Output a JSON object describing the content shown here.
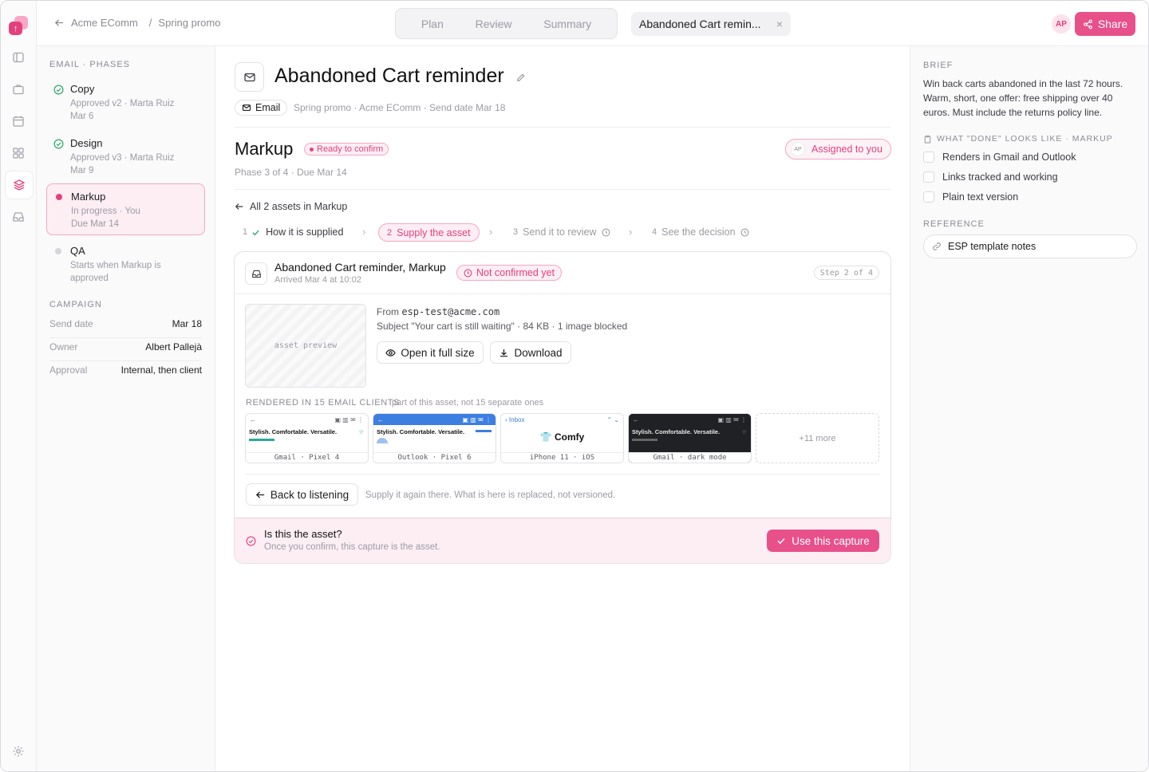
{
  "colors": {
    "accent": "#e5407e",
    "success": "#2aa867",
    "muted": "#9b9ba3"
  },
  "rail": {
    "icons": [
      "app-logo",
      "sidebar-toggle-icon",
      "briefcase-icon",
      "calendar-icon",
      "grid-icon",
      "layers-icon",
      "inbox-icon",
      "settings-icon"
    ]
  },
  "breadcrumb": {
    "parent": "Acme EComm",
    "separator": "/",
    "current": "Spring promo"
  },
  "tabs": [
    "Plan",
    "Review",
    "Summary"
  ],
  "doc_tab": {
    "title": "Abandoned Cart remin...",
    "close": "×"
  },
  "user": {
    "initials": "AP"
  },
  "share_label": "Share",
  "sidebar": {
    "phases_header": "EMAIL · PHASES",
    "phases": [
      {
        "title": "Copy",
        "sub": "Approved v2 · Marta Ruiz",
        "date": "Mar 6",
        "status": "done"
      },
      {
        "title": "Design",
        "sub": "Approved v3 · Marta Ruiz",
        "date": "Mar 9",
        "status": "done"
      },
      {
        "title": "Markup",
        "sub": "In progress · You",
        "date": "Due Mar 14",
        "status": "active"
      },
      {
        "title": "QA",
        "sub": "Starts when Markup is",
        "date": "approved",
        "status": "pending"
      }
    ],
    "campaign_header": "CAMPAIGN",
    "campaign": [
      {
        "k": "Send date",
        "v": "Mar 18"
      },
      {
        "k": "Owner",
        "v": "Albert Pallejà"
      },
      {
        "k": "Approval",
        "v": "Internal, then client"
      }
    ]
  },
  "main": {
    "title": "Abandoned Cart reminder",
    "channel": "Email",
    "meta": "Spring promo · Acme EComm · Send date Mar 18",
    "phase_title": "Markup",
    "phase_badge": "Ready to confirm",
    "phase_meta": "Phase 3 of 4 · Due Mar 14",
    "assigned": "Assigned to you",
    "assigned_initials": "AP",
    "back_all": "All 2 assets in Markup",
    "steps": [
      {
        "n": "1",
        "label": "How it is supplied",
        "state": "done"
      },
      {
        "n": "2",
        "label": "Supply the asset",
        "state": "current"
      },
      {
        "n": "3",
        "label": "Send it to review",
        "state": "future"
      },
      {
        "n": "4",
        "label": "See the decision",
        "state": "future"
      }
    ],
    "card": {
      "title": "Abandoned Cart reminder, Markup",
      "arrived": "Arrived Mar 4 at 10:02",
      "badge": "Not confirmed yet",
      "step": "Step 2 of 4",
      "preview_label": "asset preview",
      "from_label": "From",
      "from": "esp-test@acme.com",
      "subject_line": "Subject \"Your cart is still waiting\" · 84 KB · 1 image blocked",
      "open_label": "Open it full size",
      "download_label": "Download",
      "rendered_header": "RENDERED IN 15 EMAIL CLIENTS",
      "rendered_note": "part of this asset, not 15 separate ones",
      "clients": [
        {
          "cap": "Gmail · Pixel 4",
          "text": "Stylish. Comfortable. Versatile."
        },
        {
          "cap": "Outlook · Pixel 6",
          "text": "Stylish. Comfortable. Versatile."
        },
        {
          "cap": "iPhone 11 · iOS",
          "text": "Comfy",
          "bar": "Inbox"
        },
        {
          "cap": "Gmail · dark mode",
          "text": "Stylish. Comfortable. Versatile."
        }
      ],
      "more": "+11 more",
      "back_listening": "Back to listening",
      "supply_note": "Supply it again there. What is here is replaced, not versioned.",
      "confirm_q": "Is this the asset?",
      "confirm_sub": "Once you confirm, this capture is the asset.",
      "use_capture": "Use this capture"
    }
  },
  "right": {
    "brief_header": "BRIEF",
    "brief": "Win back carts abandoned in the last 72 hours. Warm, short, one offer: free shipping over 40 euros. Must include the returns policy line.",
    "done_header": "WHAT \"DONE\" LOOKS LIKE · MARKUP",
    "checklist": [
      "Renders in Gmail and Outlook",
      "Links tracked and working",
      "Plain text version"
    ],
    "reference_header": "REFERENCE",
    "reference": "ESP template notes"
  }
}
